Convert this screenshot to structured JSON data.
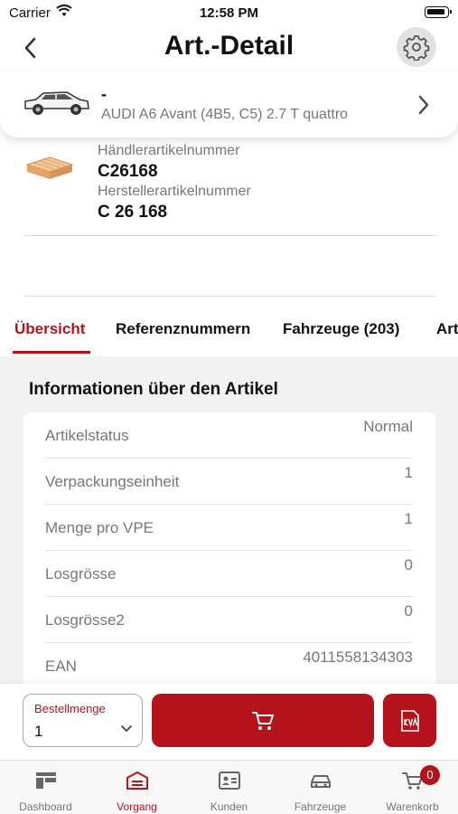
{
  "status_bar": {
    "carrier": "Carrier",
    "time": "12:58 PM"
  },
  "nav": {
    "title": "Art.-Detail"
  },
  "vehicle": {
    "name": "-",
    "model": "AUDI A6 Avant (4B5, C5) 2.7 T quattro"
  },
  "article": {
    "dealer_label": "Händlerartikelnummer",
    "dealer_number": "C26168",
    "manufacturer_label": "Herstellerartikelnummer",
    "manufacturer_number": "C 26 168"
  },
  "tabs": [
    {
      "label": "Übersicht",
      "active": true
    },
    {
      "label": "Referenznummern"
    },
    {
      "label": "Fahrzeuge (203)"
    },
    {
      "label": "Art"
    }
  ],
  "info": {
    "title": "Informationen über den Artikel",
    "rows": [
      {
        "key": "Artikelstatus",
        "value": "Normal"
      },
      {
        "key": "Verpackungseinheit",
        "value": "1"
      },
      {
        "key": "Menge pro VPE",
        "value": "1"
      },
      {
        "key": "Losgrösse",
        "value": "0"
      },
      {
        "key": "Losgrösse2",
        "value": "0"
      },
      {
        "key": "EAN",
        "value": "4011558134303"
      }
    ]
  },
  "order": {
    "qty_label": "Bestellmenge",
    "qty_value": "1"
  },
  "tab_bar": {
    "items": [
      {
        "label": "Dashboard",
        "icon": "dashboard-icon"
      },
      {
        "label": "Vorgang",
        "icon": "vorgang-icon",
        "active": true
      },
      {
        "label": "Kunden",
        "icon": "kunden-icon"
      },
      {
        "label": "Fahrzeuge",
        "icon": "car-icon"
      },
      {
        "label": "Warenkorb",
        "icon": "cart-icon",
        "badge": "0"
      }
    ]
  },
  "colors": {
    "accent": "#b5121b",
    "muted_text": "#777777",
    "background": "#f2f2f2"
  }
}
